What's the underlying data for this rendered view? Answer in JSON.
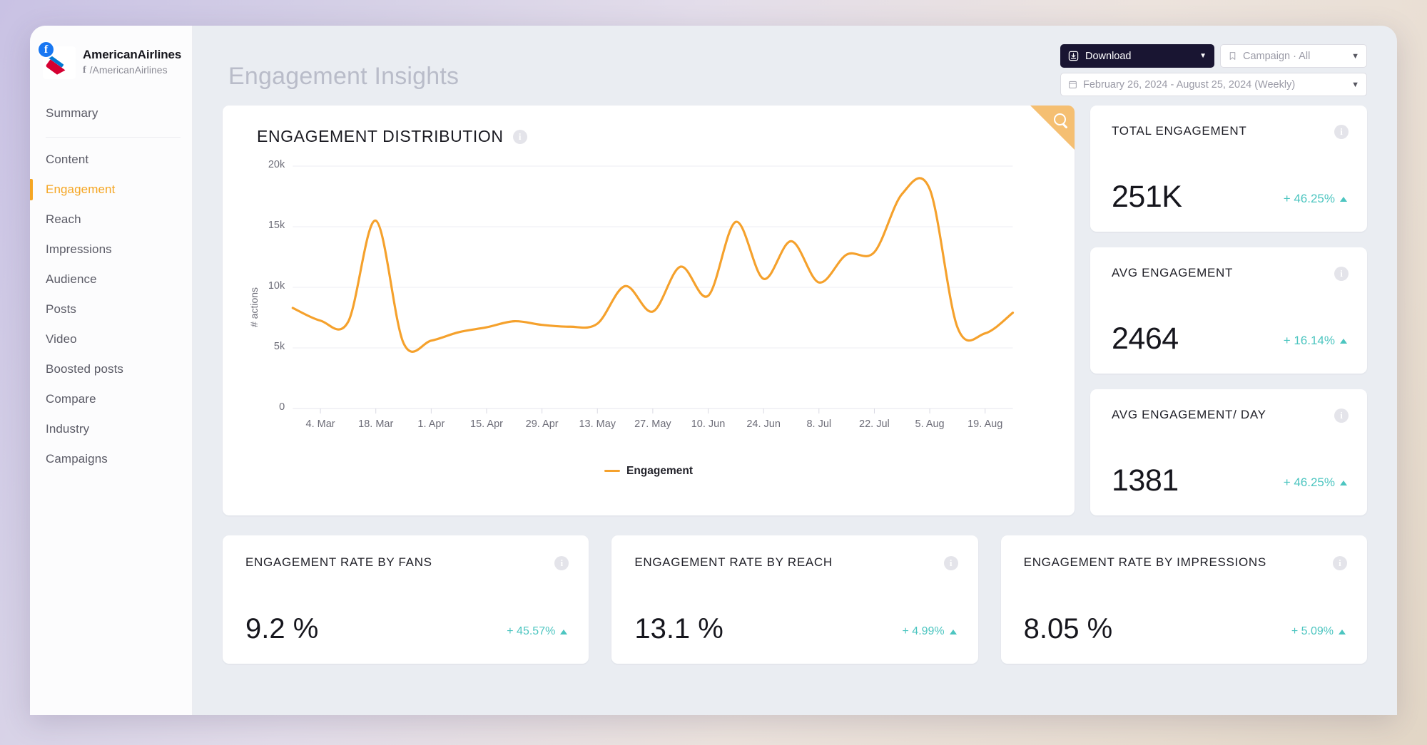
{
  "sidebar": {
    "profile": {
      "name": "AmericanAirlines",
      "handle": "/AmericanAirlines",
      "network_glyph": "f",
      "badge_icon": "facebook-icon"
    },
    "items": [
      {
        "label": "Summary",
        "active": false
      },
      {
        "label": "Content",
        "active": false
      },
      {
        "label": "Engagement",
        "active": true
      },
      {
        "label": "Reach",
        "active": false
      },
      {
        "label": "Impressions",
        "active": false
      },
      {
        "label": "Audience",
        "active": false
      },
      {
        "label": "Posts",
        "active": false
      },
      {
        "label": "Video",
        "active": false
      },
      {
        "label": "Boosted posts",
        "active": false
      },
      {
        "label": "Compare",
        "active": false
      },
      {
        "label": "Industry",
        "active": false
      },
      {
        "label": "Campaigns",
        "active": false
      }
    ]
  },
  "header": {
    "title": "Engagement Insights",
    "download_label": "Download",
    "download_icon": "download-icon",
    "caret_icon": "chevron-down-icon",
    "campaign_filter": "Campaign · All",
    "campaign_icon": "bookmark-icon",
    "date_range": "February 26, 2024 - August 25, 2024 (Weekly)",
    "calendar_icon": "calendar-icon"
  },
  "chart_card": {
    "title": "ENGAGEMENT DISTRIBUTION",
    "info_icon": "info-icon",
    "search_icon": "search-icon"
  },
  "chart_data": {
    "type": "line",
    "title": "ENGAGEMENT DISTRIBUTION",
    "xlabel": "",
    "ylabel": "# actions",
    "ylim": [
      0,
      20000
    ],
    "yticks": [
      0,
      5000,
      10000,
      15000,
      20000
    ],
    "ytick_labels": [
      "0",
      "5k",
      "10k",
      "15k",
      "20k"
    ],
    "grid": true,
    "legend": [
      "Engagement"
    ],
    "legend_position": "bottom",
    "line_color": "#f5a12c",
    "xtick_labels": [
      "4. Mar",
      "18. Mar",
      "1. Apr",
      "15. Apr",
      "29. Apr",
      "13. May",
      "27. May",
      "10. Jun",
      "24. Jun",
      "8. Jul",
      "22. Jul",
      "5. Aug",
      "19. Aug"
    ],
    "series": [
      {
        "name": "Engagement",
        "x": [
          "26. Feb",
          "4. Mar",
          "11. Mar",
          "18. Mar",
          "25. Mar",
          "1. Apr",
          "8. Apr",
          "15. Apr",
          "22. Apr",
          "29. Apr",
          "6. May",
          "13. May",
          "20. May",
          "27. May",
          "3. Jun",
          "10. Jun",
          "17. Jun",
          "24. Jun",
          "1. Jul",
          "8. Jul",
          "15. Jul",
          "22. Jul",
          "29. Jul",
          "5. Aug",
          "12. Aug",
          "19. Aug",
          "25. Aug"
        ],
        "values": [
          8300,
          7250,
          7150,
          15500,
          5400,
          5600,
          6300,
          6700,
          7200,
          6900,
          6750,
          7000,
          10100,
          8000,
          11700,
          9300,
          15400,
          10700,
          13800,
          10400,
          12700,
          12900,
          17700,
          18100,
          6700,
          6200,
          7900
        ]
      }
    ]
  },
  "kpi_cards": [
    {
      "title": "TOTAL ENGAGEMENT",
      "value": "251K",
      "delta": "+ 46.25%",
      "trend": "up",
      "info_icon": "info-icon"
    },
    {
      "title": "AVG ENGAGEMENT",
      "value": "2464",
      "delta": "+ 16.14%",
      "trend": "up",
      "info_icon": "info-icon"
    },
    {
      "title": "AVG ENGAGEMENT/ DAY",
      "value": "1381",
      "delta": "+ 46.25%",
      "trend": "up",
      "info_icon": "info-icon"
    }
  ],
  "rate_cards": [
    {
      "title": "ENGAGEMENT RATE BY FANS",
      "value": "9.2 %",
      "delta": "+ 45.57%",
      "trend": "up",
      "info_icon": "info-icon"
    },
    {
      "title": "ENGAGEMENT RATE BY REACH",
      "value": "13.1 %",
      "delta": "+ 4.99%",
      "trend": "up",
      "info_icon": "info-icon"
    },
    {
      "title": "ENGAGEMENT RATE BY IMPRESSIONS",
      "value": "8.05 %",
      "delta": "+ 5.09%",
      "trend": "up",
      "info_icon": "info-icon"
    }
  ],
  "colors": {
    "accent_orange": "#f5a12c",
    "positive_teal": "#4cc5c0",
    "dark_navy": "#191532"
  }
}
